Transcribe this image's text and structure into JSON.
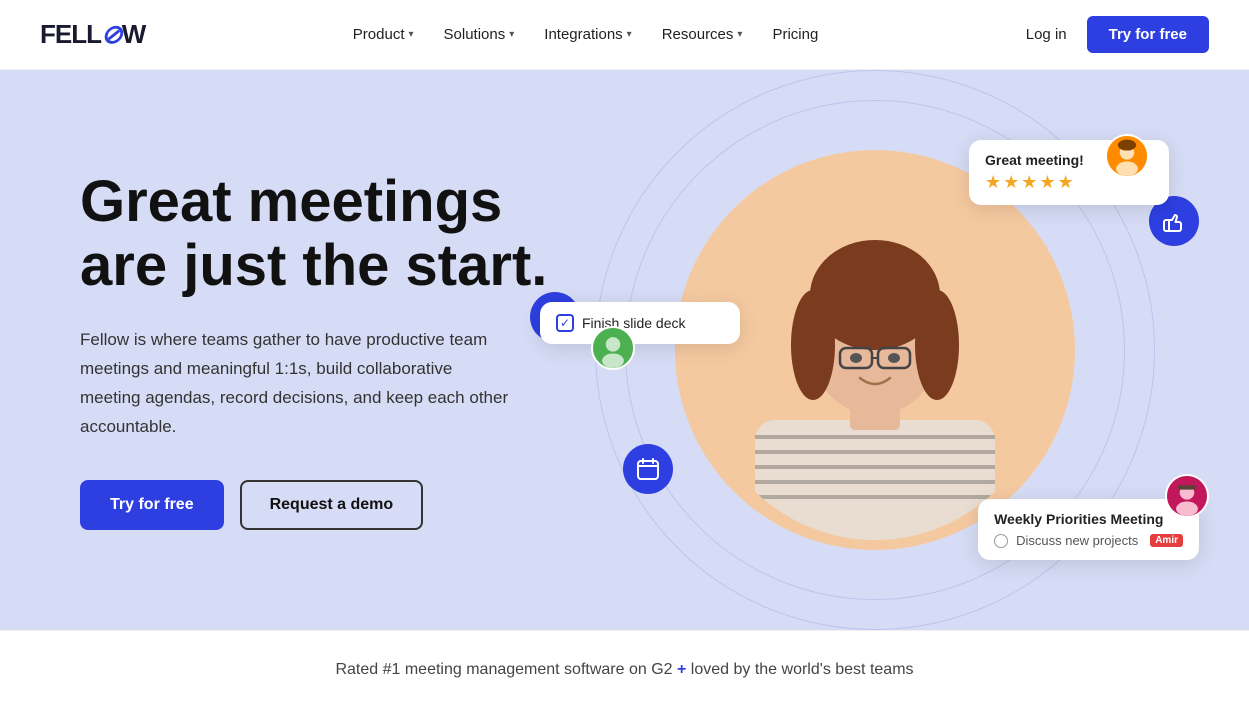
{
  "logo": {
    "text_start": "FELL",
    "text_slash": "⌀",
    "text_end": "W"
  },
  "nav": {
    "links": [
      {
        "label": "Product",
        "has_dropdown": true
      },
      {
        "label": "Solutions",
        "has_dropdown": true
      },
      {
        "label": "Integrations",
        "has_dropdown": true
      },
      {
        "label": "Resources",
        "has_dropdown": true
      },
      {
        "label": "Pricing",
        "has_dropdown": false
      }
    ],
    "login_label": "Log in",
    "cta_label": "Try for free"
  },
  "hero": {
    "title": "Great meetings are just the start.",
    "description": "Fellow is where teams gather to have productive team meetings and meaningful 1:1s, build collaborative meeting agendas, record decisions, and keep each other accountable.",
    "btn_primary": "Try for free",
    "btn_secondary": "Request a demo"
  },
  "float_cards": {
    "rating": {
      "title": "Great meeting!",
      "stars": "★★★★★"
    },
    "task": {
      "label": "Finish slide deck"
    },
    "meeting": {
      "title": "Weekly Priorities Meeting",
      "item": "Discuss new projects",
      "assignee": "Amir"
    }
  },
  "footer_bar": {
    "text_part1": "Rated #1 meeting management software on G2",
    "text_plus": " + ",
    "text_part2": "loved by the world's best teams"
  },
  "icons": {
    "check": "✓",
    "calendar": "📅",
    "thumbsup": "👍",
    "chevron": "▾"
  }
}
